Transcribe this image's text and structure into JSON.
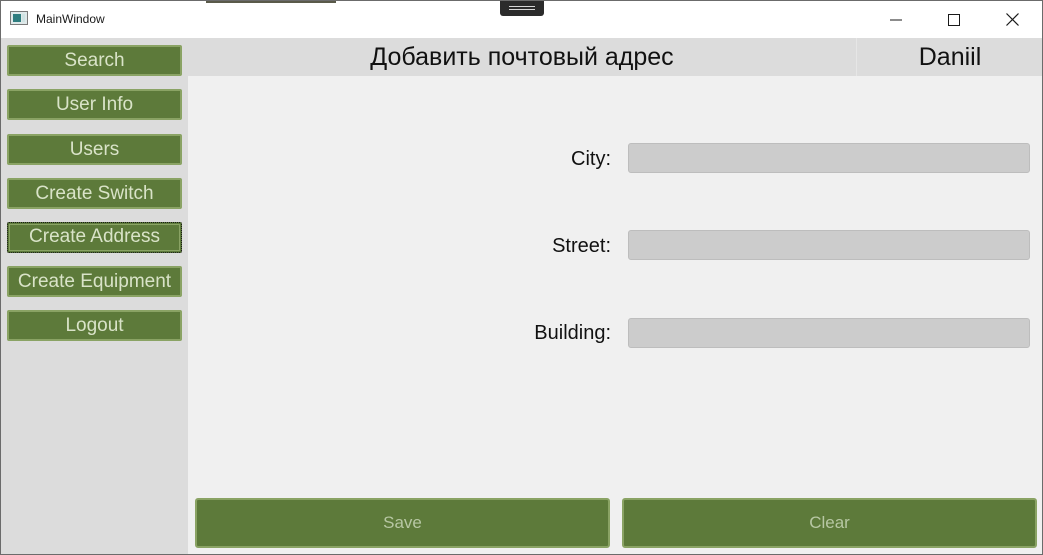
{
  "window": {
    "title": "MainWindow"
  },
  "sidebar": {
    "items": [
      {
        "label": "Search"
      },
      {
        "label": "User Info"
      },
      {
        "label": "Users"
      },
      {
        "label": "Create Switch"
      },
      {
        "label": "Create Address"
      },
      {
        "label": "Create Equipment"
      },
      {
        "label": "Logout"
      }
    ]
  },
  "header": {
    "title": "Добавить почтовый адрес",
    "user": "Daniil"
  },
  "form": {
    "city_label": "City:",
    "city_value": "",
    "street_label": "Street:",
    "street_value": "",
    "building_label": "Building:",
    "building_value": ""
  },
  "actions": {
    "save_label": "Save",
    "clear_label": "Clear"
  },
  "colors": {
    "accent": "#5d7a3a",
    "accent_border": "#8aa364",
    "sidebar_bg": "#dcdcdc",
    "content_bg": "#f0f0f0",
    "input_bg": "#cccccc"
  }
}
